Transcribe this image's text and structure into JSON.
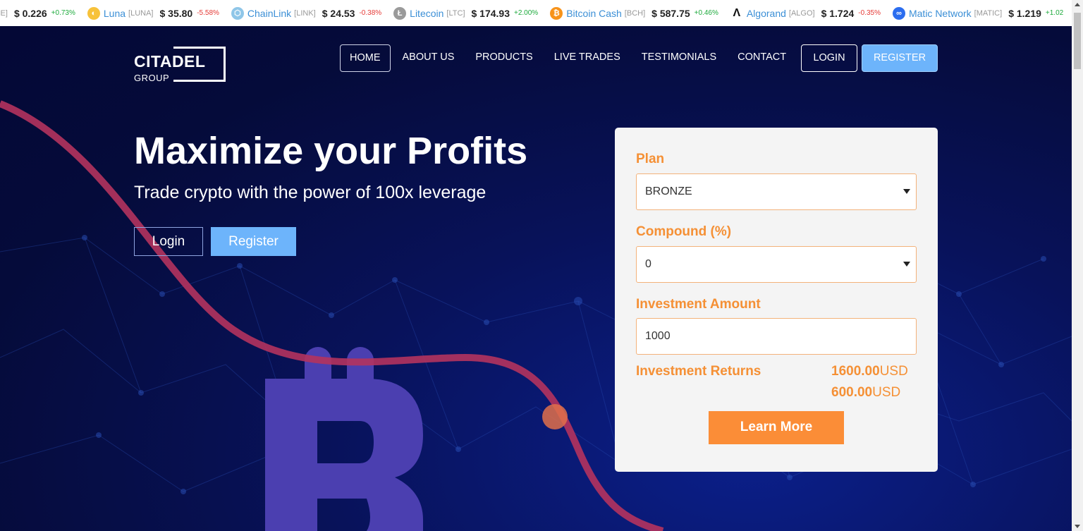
{
  "ticker": [
    {
      "name": "",
      "symbol": "GE]",
      "price": "$ 0.226",
      "change": "+0.73%",
      "dir": "up",
      "icon": "none",
      "color": "#ffffff"
    },
    {
      "name": "Luna",
      "symbol": "[LUNA]",
      "price": "$ 35.80",
      "change": "-5.58%",
      "dir": "dn",
      "icon": "luna-icon",
      "color": "#f7c23a"
    },
    {
      "name": "ChainLink",
      "symbol": "[LINK]",
      "price": "$ 24.53",
      "change": "-0.38%",
      "dir": "dn",
      "icon": "chainlink-icon",
      "color": "#8fc6e8"
    },
    {
      "name": "Litecoin",
      "symbol": "[LTC]",
      "price": "$ 174.93",
      "change": "+2.00%",
      "dir": "up",
      "icon": "litecoin-icon",
      "color": "#9a9a9a"
    },
    {
      "name": "Bitcoin Cash",
      "symbol": "[BCH]",
      "price": "$ 587.75",
      "change": "+0.46%",
      "dir": "up",
      "icon": "bitcoin-cash-icon",
      "color": "#f7931a"
    },
    {
      "name": "Algorand",
      "symbol": "[ALGO]",
      "price": "$ 1.724",
      "change": "-0.35%",
      "dir": "dn",
      "icon": "algorand-icon",
      "color": "#111111"
    },
    {
      "name": "Matic Network",
      "symbol": "[MATIC]",
      "price": "$ 1.219",
      "change": "+1.02",
      "dir": "up",
      "icon": "matic-icon",
      "color": "#2b6def"
    }
  ],
  "logo": {
    "line1": "CITADEL",
    "line2": "GROUP"
  },
  "nav": {
    "items": [
      "HOME",
      "ABOUT US",
      "PRODUCTS",
      "LIVE TRADES",
      "TESTIMONIALS",
      "CONTACT"
    ],
    "login": "LOGIN",
    "register": "REGISTER"
  },
  "hero": {
    "title": "Maximize your Profits",
    "subtitle": "Trade crypto with the power of 100x leverage",
    "login": "Login",
    "register": "Register"
  },
  "calculator": {
    "plan_label": "Plan",
    "plan_value": "BRONZE",
    "compound_label": "Compound (%)",
    "compound_value": "0",
    "amount_label": "Investment Amount",
    "amount_value": "1000",
    "returns_label": "Investment Returns",
    "returns_total": "1600.00",
    "returns_profit": "600.00",
    "currency": "USD",
    "cta": "Learn More"
  },
  "colors": {
    "accent": "#f59035",
    "brand_blue": "#6db4fb",
    "hero_bg": "#050b3a"
  }
}
